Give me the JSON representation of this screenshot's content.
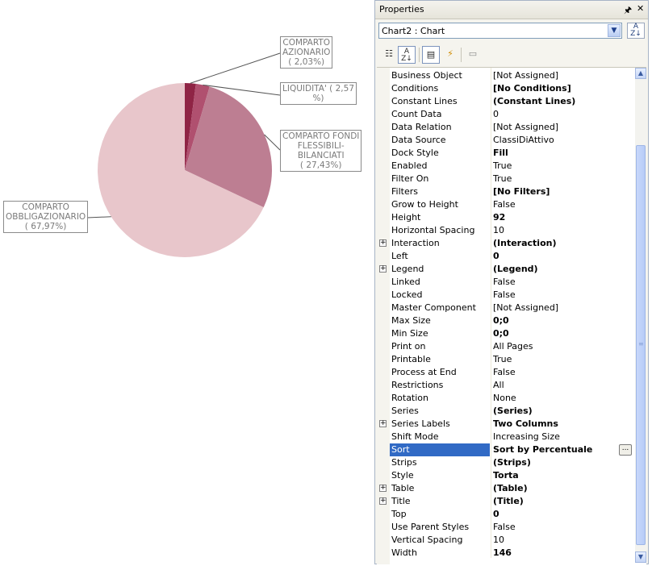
{
  "chart": {
    "labels": [
      {
        "lines": [
          "COMPARTO",
          "AZIONARIO",
          "( 2,03%)"
        ]
      },
      {
        "lines": [
          "LIQUIDITA' ( 2,57",
          "%)"
        ]
      },
      {
        "lines": [
          "COMPARTO FONDI",
          "FLESSIBILI-",
          "BILANCIATI",
          "( 27,43%)"
        ]
      },
      {
        "lines": [
          "COMPARTO",
          "OBBLIGAZIONARIO",
          "( 67,97%)"
        ]
      }
    ]
  },
  "chart_data": {
    "type": "pie",
    "categories": [
      "COMPARTO AZIONARIO",
      "LIQUIDITA'",
      "COMPARTO FONDI FLESSIBILI-BILANCIATI",
      "COMPARTO OBBLIGAZIONARIO"
    ],
    "values": [
      2.03,
      2.57,
      27.43,
      67.97
    ],
    "colors": [
      "#8f2445",
      "#b0506f",
      "#bd7e92",
      "#e8c6cb"
    ]
  },
  "panel": {
    "title": "Properties",
    "pin_icon": "pin-icon",
    "close_icon": "close-icon",
    "object_selector": "Chart2 : Chart",
    "toolbar_icons": [
      "categorized-icon",
      "alphabetical-icon",
      "properties-icon",
      "events-icon",
      "property-pages-icon"
    ]
  },
  "properties": [
    {
      "name": "Business Object",
      "value": "[Not Assigned]",
      "bold": false,
      "expandable": false
    },
    {
      "name": "Conditions",
      "value": "[No Conditions]",
      "bold": true,
      "expandable": false
    },
    {
      "name": "Constant Lines",
      "value": "(Constant Lines)",
      "bold": true,
      "expandable": false
    },
    {
      "name": "Count Data",
      "value": "0",
      "bold": false,
      "expandable": false
    },
    {
      "name": "Data Relation",
      "value": "[Not Assigned]",
      "bold": false,
      "expandable": false
    },
    {
      "name": "Data Source",
      "value": "ClassiDiAttivo",
      "bold": false,
      "expandable": false
    },
    {
      "name": "Dock Style",
      "value": "Fill",
      "bold": true,
      "expandable": false
    },
    {
      "name": "Enabled",
      "value": "True",
      "bold": false,
      "expandable": false
    },
    {
      "name": "Filter On",
      "value": "True",
      "bold": false,
      "expandable": false
    },
    {
      "name": "Filters",
      "value": "[No Filters]",
      "bold": true,
      "expandable": false
    },
    {
      "name": "Grow to Height",
      "value": "False",
      "bold": false,
      "expandable": false
    },
    {
      "name": "Height",
      "value": "92",
      "bold": true,
      "expandable": false
    },
    {
      "name": "Horizontal Spacing",
      "value": "10",
      "bold": false,
      "expandable": false
    },
    {
      "name": "Interaction",
      "value": "(Interaction)",
      "bold": true,
      "expandable": true
    },
    {
      "name": "Left",
      "value": "0",
      "bold": true,
      "expandable": false
    },
    {
      "name": "Legend",
      "value": "(Legend)",
      "bold": true,
      "expandable": true
    },
    {
      "name": "Linked",
      "value": "False",
      "bold": false,
      "expandable": false
    },
    {
      "name": "Locked",
      "value": "False",
      "bold": false,
      "expandable": false
    },
    {
      "name": "Master Component",
      "value": "[Not Assigned]",
      "bold": false,
      "expandable": false
    },
    {
      "name": "Max Size",
      "value": "0;0",
      "bold": true,
      "expandable": false
    },
    {
      "name": "Min Size",
      "value": "0;0",
      "bold": true,
      "expandable": false
    },
    {
      "name": "Print on",
      "value": "All Pages",
      "bold": false,
      "expandable": false
    },
    {
      "name": "Printable",
      "value": "True",
      "bold": false,
      "expandable": false
    },
    {
      "name": "Process at End",
      "value": "False",
      "bold": false,
      "expandable": false
    },
    {
      "name": "Restrictions",
      "value": "All",
      "bold": false,
      "expandable": false
    },
    {
      "name": "Rotation",
      "value": "None",
      "bold": false,
      "expandable": false
    },
    {
      "name": "Series",
      "value": "(Series)",
      "bold": true,
      "expandable": false
    },
    {
      "name": "Series Labels",
      "value": "Two Columns",
      "bold": true,
      "expandable": true
    },
    {
      "name": "Shift Mode",
      "value": "Increasing Size",
      "bold": false,
      "expandable": false
    },
    {
      "name": "Sort",
      "value": "Sort by Percentuale",
      "bold": true,
      "expandable": false,
      "selected": true
    },
    {
      "name": "Strips",
      "value": "(Strips)",
      "bold": true,
      "expandable": false
    },
    {
      "name": "Style",
      "value": "Torta",
      "bold": true,
      "expandable": false
    },
    {
      "name": "Table",
      "value": "(Table)",
      "bold": true,
      "expandable": true
    },
    {
      "name": "Title",
      "value": "(Title)",
      "bold": true,
      "expandable": true
    },
    {
      "name": "Top",
      "value": "0",
      "bold": true,
      "expandable": false
    },
    {
      "name": "Use Parent Styles",
      "value": "False",
      "bold": false,
      "expandable": false
    },
    {
      "name": "Vertical Spacing",
      "value": "10",
      "bold": false,
      "expandable": false
    },
    {
      "name": "Width",
      "value": "146",
      "bold": true,
      "expandable": false
    }
  ]
}
